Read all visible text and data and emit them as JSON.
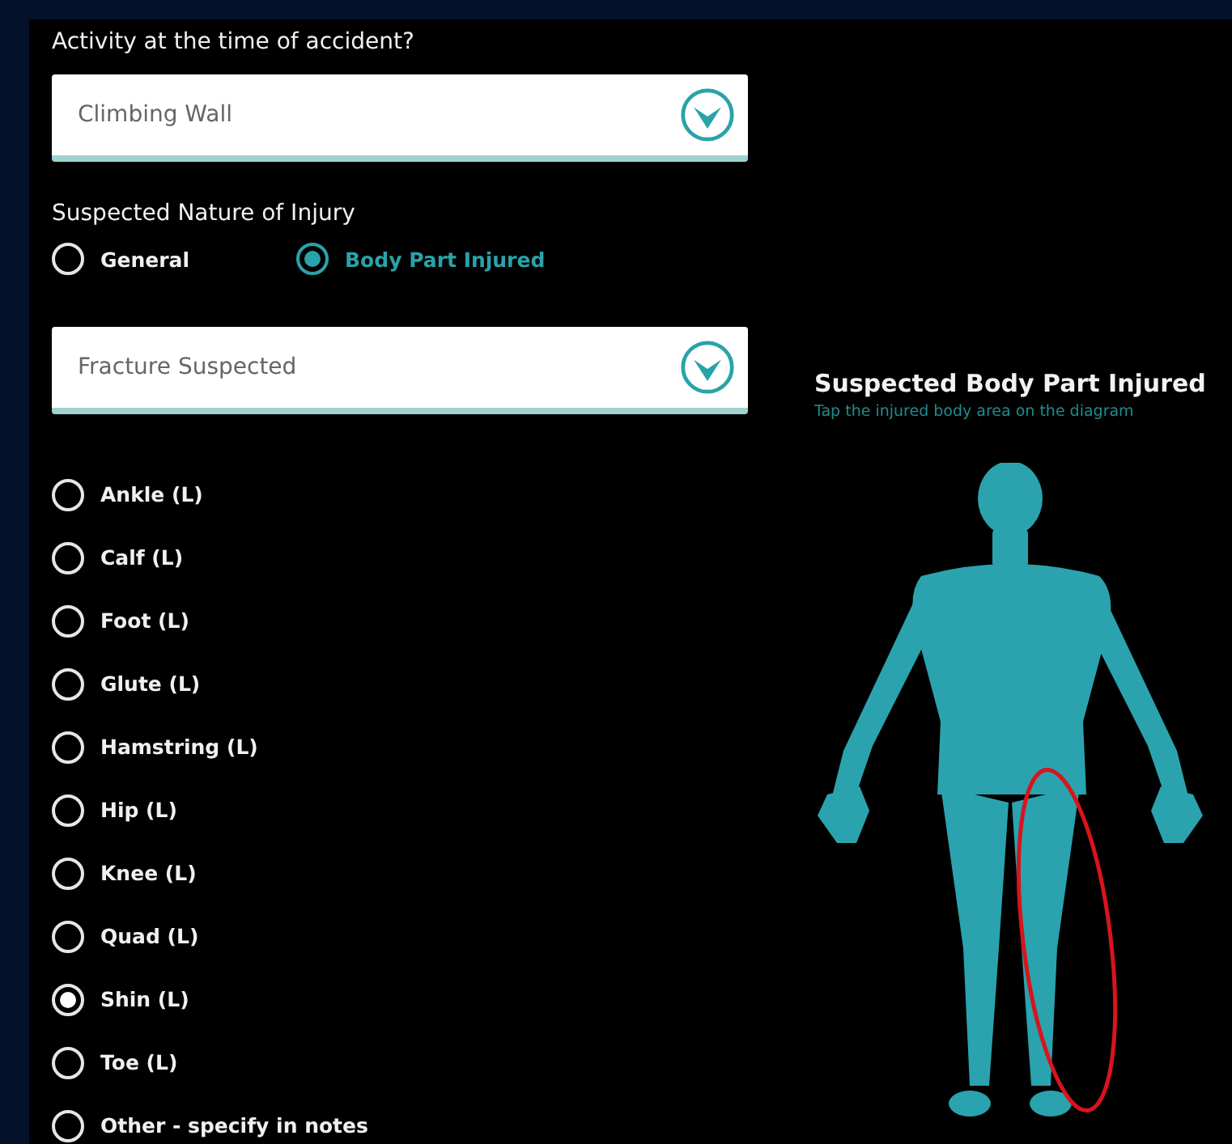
{
  "activity": {
    "label": "Activity at the time of accident?",
    "value": "Climbing Wall"
  },
  "nature": {
    "label": "Suspected Nature of Injury",
    "options": [
      {
        "label": "General",
        "selected": false
      },
      {
        "label": "Body Part Injured",
        "selected": true
      }
    ]
  },
  "injury_type": {
    "value": "Fracture Suspected"
  },
  "body_parts": [
    {
      "label": "Ankle (L)",
      "selected": false
    },
    {
      "label": "Calf (L)",
      "selected": false
    },
    {
      "label": "Foot (L)",
      "selected": false
    },
    {
      "label": "Glute (L)",
      "selected": false
    },
    {
      "label": "Hamstring (L)",
      "selected": false
    },
    {
      "label": "Hip (L)",
      "selected": false
    },
    {
      "label": "Knee (L)",
      "selected": false
    },
    {
      "label": "Quad (L)",
      "selected": false
    },
    {
      "label": "Shin (L)",
      "selected": true
    },
    {
      "label": "Toe (L)",
      "selected": false
    },
    {
      "label": "Other - specify in notes",
      "selected": false
    }
  ],
  "diagram": {
    "title": "Suspected Body Part Injured",
    "hint": "Tap the injured body area on the diagram"
  }
}
